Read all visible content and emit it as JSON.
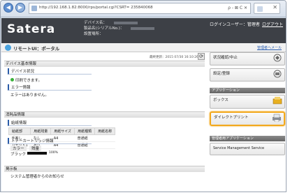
{
  "browser": {
    "url": "http://192.168.1.82:8000/rps/portal.cgi?CSRT= 235840068",
    "url_tools": "ρ - ⊠ C ✕",
    "tab_close": "✕",
    "back_glyph": "◀",
    "forward_glyph": "▶"
  },
  "header": {
    "logo": "Satera",
    "device_name_label": "デバイス名：",
    "product_name_label": "製品名(シリアルNo.)：",
    "location_label": "設置場所：",
    "login_user": "ログインユーザー：管理者",
    "logout": "ログアウト"
  },
  "subheader": {
    "title": "リモートUI：ポータル",
    "mail_link": "管理者へメール"
  },
  "main": {
    "last_update": "最終更新：2015 07/30 16:10:26",
    "refresh_glyph": "⟳",
    "device_basic_info": "デバイス基本情報",
    "device_status_head": "デバイス状況",
    "device_status_text": "印刷できます。",
    "error_info_head": "エラー情報",
    "error_info_text": "エラーはありません。",
    "consumables_info": "消耗品情報",
    "paper_info_head": "給紙情報",
    "media_table": {
      "headers": [
        "給紙部",
        "用紙残量",
        "用紙サイズ",
        "用紙種類",
        "用紙名称"
      ],
      "rows": [
        [
          "手差し",
          "なし",
          "A4",
          "普通紙",
          ""
        ],
        [
          "カセット1",
          "あり",
          "A4",
          "普通紙",
          ""
        ]
      ]
    },
    "toner_head": "トナーカートリッジ情報",
    "toner_col_color": "カラー",
    "toner_col_level": "残量",
    "toner_color": "ブラック",
    "toner_level_label": "100%",
    "toner_level": 1.0,
    "messages_head": "掲示板",
    "messages_text": "システム管理者からのお知らせ"
  },
  "side": {
    "status_button": "状況確認/中止",
    "settings_button": "設定/登録",
    "applications_head": "アプリケーション",
    "box_button": "ボックス",
    "direct_print_button": "ダイレクトプリント",
    "mgmt_apps_head": "管理者用アプリケーション",
    "service_mgmt_button": "Service Management Service"
  },
  "colors": {
    "header_bg": "#3d4046",
    "highlight": "#f2a81c",
    "status_ok": "#3ab23a"
  }
}
